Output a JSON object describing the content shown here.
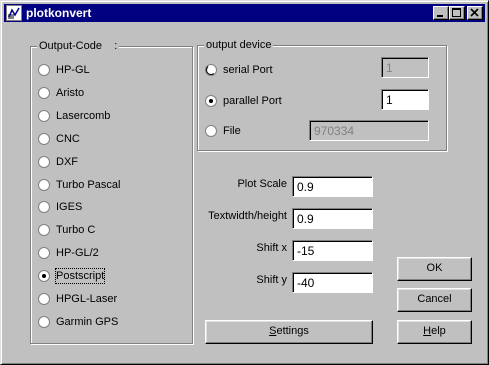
{
  "window": {
    "title": "plotkonvert"
  },
  "output_code": {
    "legend": "Output-Code    :",
    "options": [
      {
        "label": "HP-GL",
        "selected": false
      },
      {
        "label": "Aristo",
        "selected": false
      },
      {
        "label": "Lasercomb",
        "selected": false
      },
      {
        "label": "CNC",
        "selected": false
      },
      {
        "label": "DXF",
        "selected": false
      },
      {
        "label": "Turbo Pascal",
        "selected": false
      },
      {
        "label": "IGES",
        "selected": false
      },
      {
        "label": "Turbo C",
        "selected": false
      },
      {
        "label": "HP-GL/2",
        "selected": false
      },
      {
        "label": "Postscript",
        "selected": true
      },
      {
        "label": "HPGL-Laser",
        "selected": false
      },
      {
        "label": "Garmin GPS",
        "selected": false
      }
    ]
  },
  "output_device": {
    "legend": "output device",
    "serial": {
      "label": "serial Port",
      "value": "1",
      "selected": false
    },
    "parallel": {
      "label": "parallel Port",
      "value": "1",
      "selected": true
    },
    "file": {
      "label": "File",
      "value": "970334",
      "selected": false
    }
  },
  "params": {
    "plot_scale": {
      "label": "Plot Scale",
      "value": "0.9"
    },
    "textwidth": {
      "label": "Textwidth/height",
      "value": "0.9"
    },
    "shift_x": {
      "label": "Shift x",
      "value": "-15"
    },
    "shift_y": {
      "label": "Shift y",
      "value": "-40"
    }
  },
  "buttons": {
    "ok": "OK",
    "cancel": "Cancel",
    "help_prefix": "H",
    "help_rest": "elp",
    "settings_prefix": "S",
    "settings_rest": "ettings"
  }
}
